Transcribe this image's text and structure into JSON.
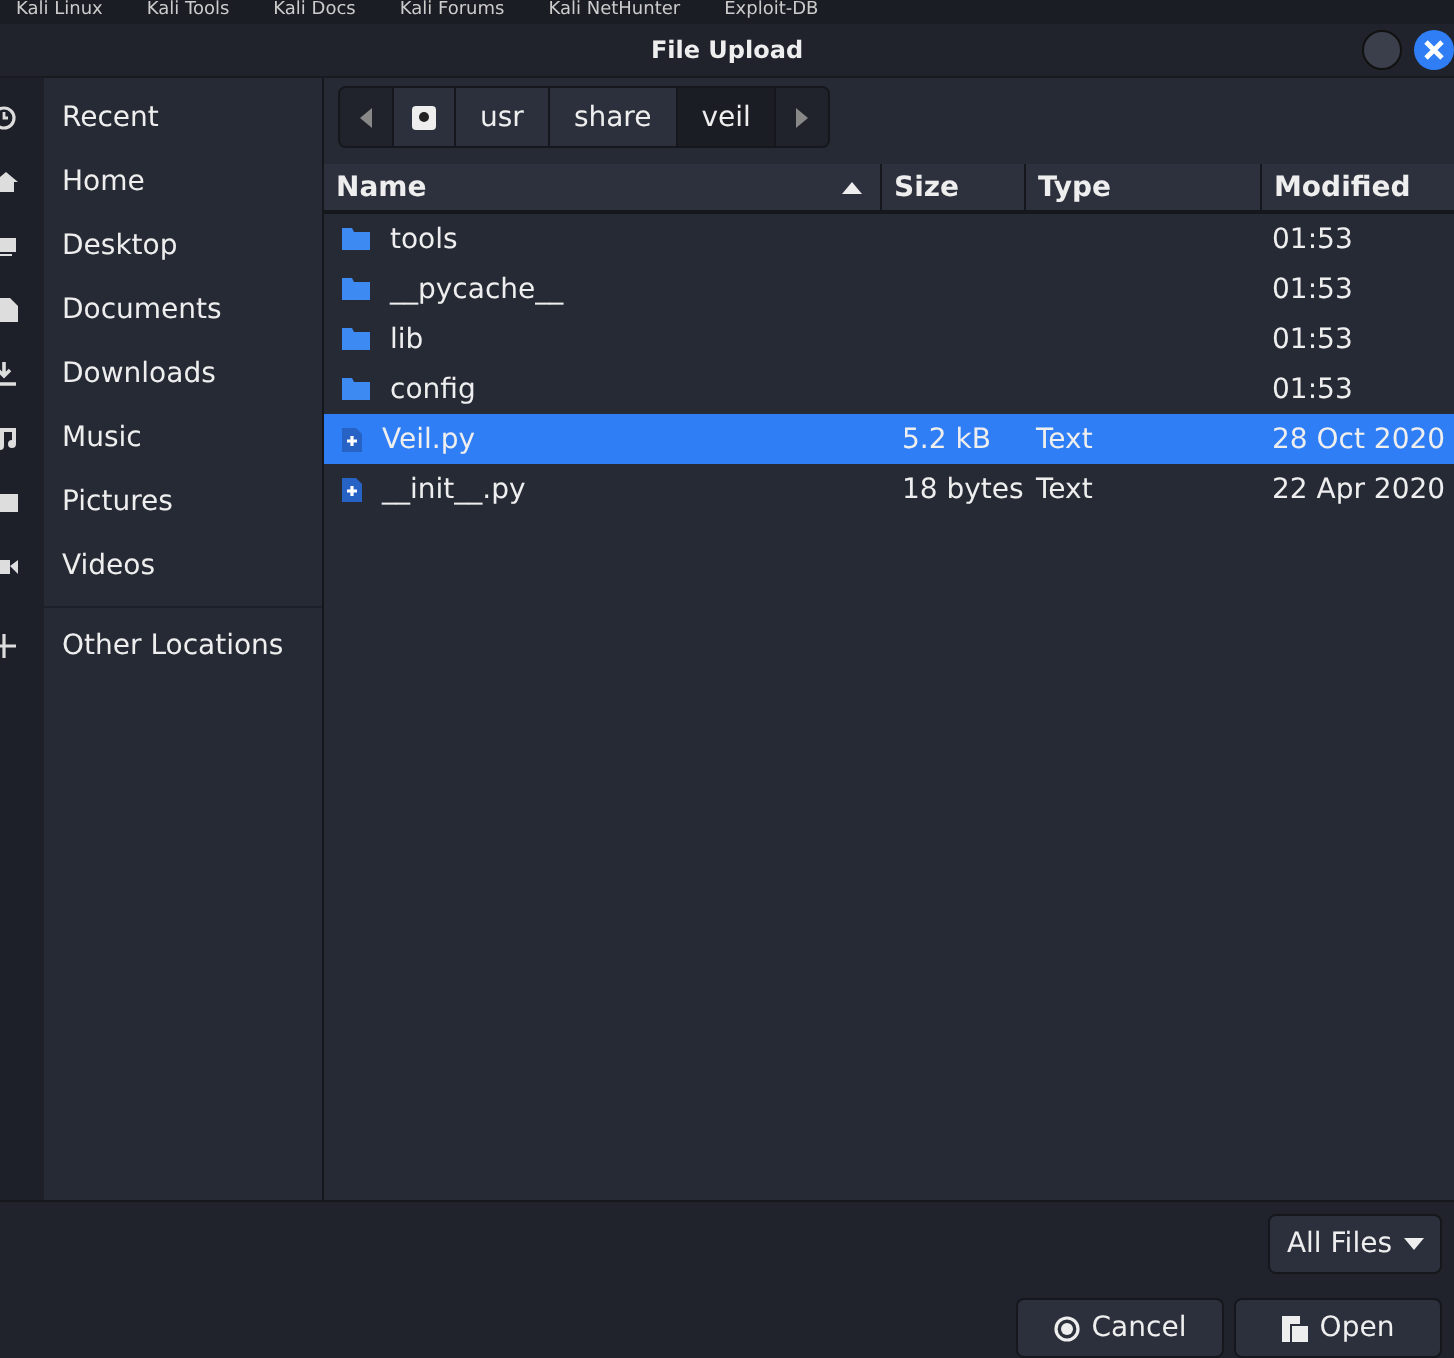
{
  "bookmarks": [
    "Kali Linux",
    "Kali Tools",
    "Kali Docs",
    "Kali Forums",
    "Kali NetHunter",
    "Exploit-DB"
  ],
  "window": {
    "title": "File Upload"
  },
  "sidebar": {
    "items": [
      {
        "label": "Recent",
        "kind": "recent",
        "selected": false
      },
      {
        "label": "Home",
        "kind": "home",
        "selected": false
      },
      {
        "label": "Desktop",
        "kind": "desktop",
        "selected": false
      },
      {
        "label": "Documents",
        "kind": "documents",
        "selected": false
      },
      {
        "label": "Downloads",
        "kind": "downloads",
        "selected": false
      },
      {
        "label": "Music",
        "kind": "music",
        "selected": false
      },
      {
        "label": "Pictures",
        "kind": "pictures",
        "selected": false
      },
      {
        "label": "Videos",
        "kind": "videos",
        "selected": false
      },
      {
        "label": "Other Locations",
        "kind": "other",
        "selected": false
      }
    ]
  },
  "path": [
    {
      "label": "usr",
      "selected": false
    },
    {
      "label": "share",
      "selected": false
    },
    {
      "label": "veil",
      "selected": true
    }
  ],
  "table": {
    "columns": [
      "Name",
      "Size",
      "Type",
      "Modified"
    ],
    "rows": [
      {
        "kind": "folder",
        "name": "tools",
        "size": "",
        "type": "",
        "modified": "01:53",
        "selected": false
      },
      {
        "kind": "folder",
        "name": "__pycache__",
        "size": "",
        "type": "",
        "modified": "01:53",
        "selected": false
      },
      {
        "kind": "folder",
        "name": "lib",
        "size": "",
        "type": "",
        "modified": "01:53",
        "selected": false
      },
      {
        "kind": "folder",
        "name": "config",
        "size": "",
        "type": "",
        "modified": "01:53",
        "selected": false
      },
      {
        "kind": "file",
        "name": "Veil.py",
        "size": "5.2 kB",
        "type": "Text",
        "modified": "28 Oct 2020",
        "selected": true
      },
      {
        "kind": "file",
        "name": "__init__.py",
        "size": "18 bytes",
        "type": "Text",
        "modified": "22 Apr 2020",
        "selected": false
      }
    ]
  },
  "filter": "All Files",
  "buttons": [
    {
      "label": "Cancel",
      "kind": "cancel"
    },
    {
      "label": "Open",
      "kind": "open"
    }
  ]
}
